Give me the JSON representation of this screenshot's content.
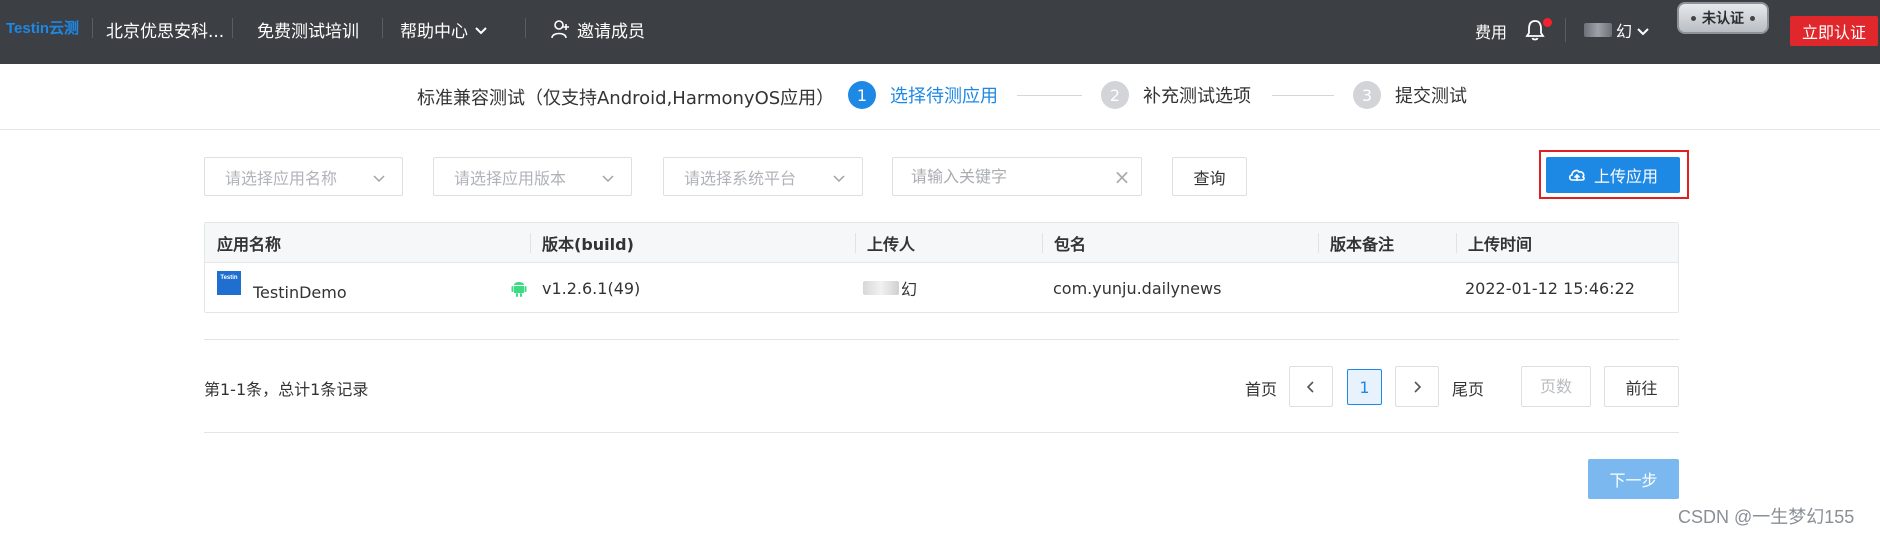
{
  "topnav": {
    "logo": "Testin云测",
    "org_name": "北京优思安科...",
    "training": "免费测试培训",
    "help": "帮助中心",
    "invite": "邀请成员",
    "fee": "费用",
    "user_name": "幻",
    "uncert_badge": "未认证",
    "certify_button": "立即认证"
  },
  "steps": {
    "title": "标准兼容测试（仅支持Android,HarmonyOS应用）",
    "items": [
      {
        "num": "1",
        "label": "选择待测应用",
        "active": true
      },
      {
        "num": "2",
        "label": "补充测试选项",
        "active": false
      },
      {
        "num": "3",
        "label": "提交测试",
        "active": false
      }
    ]
  },
  "filters": {
    "app_name_placeholder": "请选择应用名称",
    "app_version_placeholder": "请选择应用版本",
    "platform_placeholder": "请选择系统平台",
    "keyword_placeholder": "请输入关键字",
    "query_button": "查询",
    "upload_button": "上传应用"
  },
  "table": {
    "columns": [
      "应用名称",
      "版本(build)",
      "上传人",
      "包名",
      "版本备注",
      "上传时间"
    ],
    "rows": [
      {
        "app_icon_text": "Testin",
        "app_name": "TestinDemo",
        "version": "v1.2.6.1(49)",
        "uploader": "幻",
        "package": "com.yunju.dailynews",
        "note": "",
        "upload_time": "2022-01-12 15:46:22"
      }
    ]
  },
  "pagination": {
    "total": "第1-1条，总计1条记录",
    "first": "首页",
    "last": "尾页",
    "current_page": "1",
    "page_placeholder": "页数",
    "go_button": "前往"
  },
  "next_button": "下一步",
  "watermark": "CSDN @一生梦幻155",
  "colors": {
    "accent": "#1e88e5",
    "nav_bg": "#3c3f44",
    "danger": "#e0282c"
  }
}
